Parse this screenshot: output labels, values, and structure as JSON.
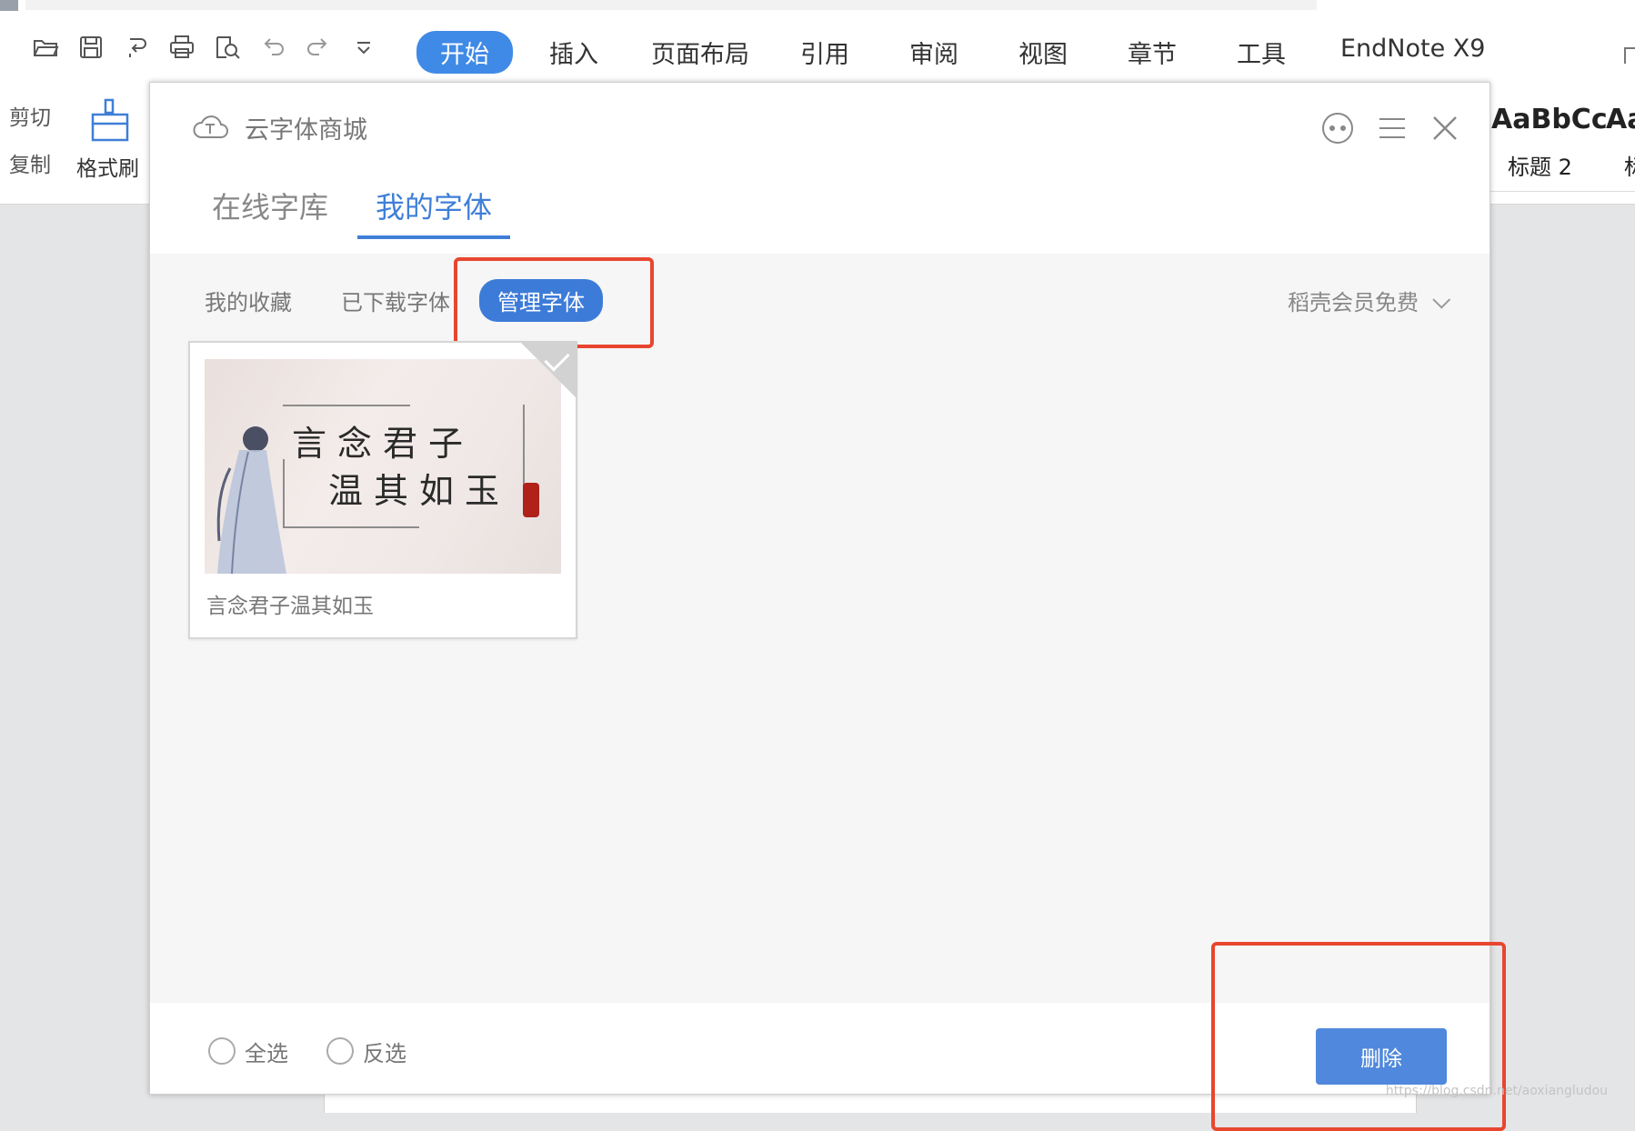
{
  "ribbon": {
    "quick_access": [
      "open-folder-icon",
      "save-icon",
      "format-painter-export-icon",
      "print-icon",
      "print-preview-icon",
      "undo-icon",
      "redo-icon",
      "more-dropdown-icon"
    ],
    "menu": [
      "开始",
      "插入",
      "页面布局",
      "引用",
      "审阅",
      "视图",
      "章节",
      "工具",
      "EndNote X9"
    ],
    "active_menu": "开始",
    "cut": "剪切",
    "copy": "复制",
    "format_painter": "格式刷",
    "style_preview": "AaBbCc",
    "style_preview2": "Aa",
    "style_name": "标题 2",
    "style_name2": "标"
  },
  "dialog": {
    "title": "云字体商城",
    "tabs": [
      "在线字库",
      "我的字体"
    ],
    "active_tab": "我的字体",
    "subtabs": [
      "我的收藏",
      "已下载字体",
      "管理字体"
    ],
    "active_subtab": "管理字体",
    "member": "稻壳会员免费",
    "font_card": {
      "preview_line1": "言念君子",
      "preview_line2": "温其如玉",
      "name": "言念君子温其如玉",
      "selected": true
    },
    "footer": {
      "select_all": "全选",
      "invert_select": "反选",
      "delete": "删除"
    }
  },
  "watermark": "https://blog.csdn.net/aoxiangludou",
  "colors": {
    "accent": "#3f7fd8",
    "highlight_box": "#e8462f",
    "delete_button": "#4f88dc"
  }
}
